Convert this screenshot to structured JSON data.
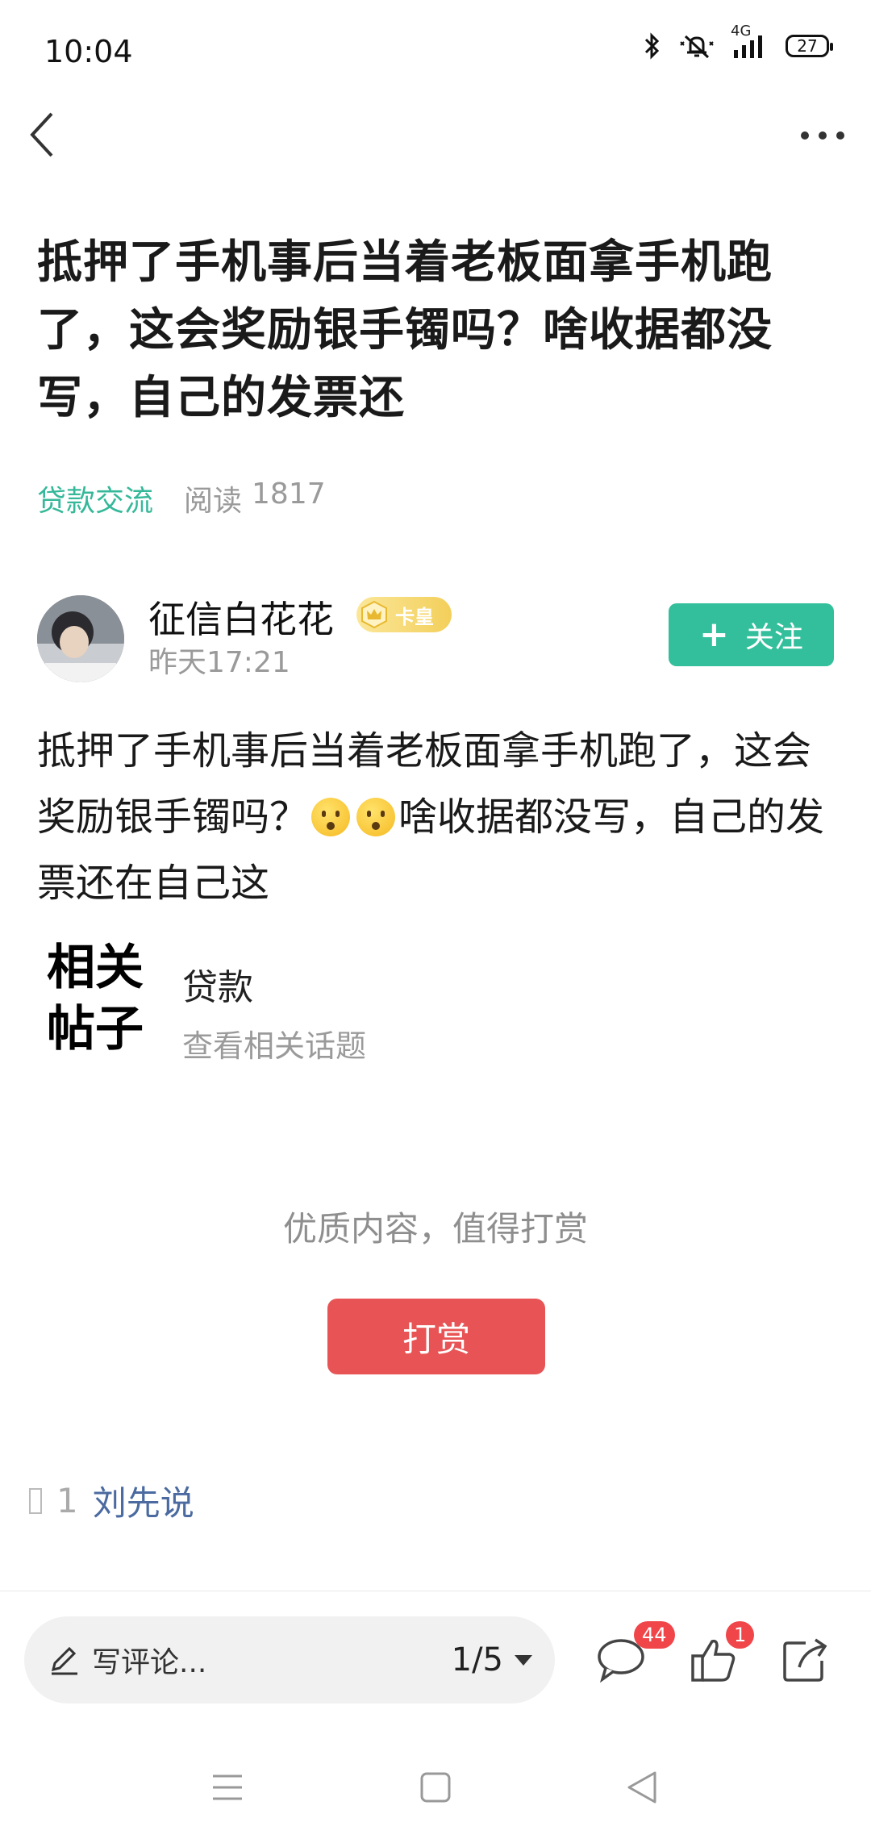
{
  "status_bar": {
    "time": "10:04",
    "network": "4G",
    "battery": "27"
  },
  "icons": {
    "back": "back-chevron-icon",
    "more": "more-dots-icon",
    "bluetooth": "bluetooth-icon",
    "mute": "mute-bell-icon",
    "signal": "signal-icon",
    "battery": "battery-icon",
    "pencil": "pencil-icon",
    "comment": "comment-icon",
    "like": "thumbs-up-icon",
    "share": "share-icon",
    "crown": "crown-icon"
  },
  "post": {
    "title": "抵押了手机事后当着老板面拿手机跑了，这会奖励银手镯吗？啥收据都没写，自己的发票还",
    "category": "贷款交流",
    "read_label": "阅读",
    "read_count": "1817",
    "body_part1": "抵押了手机事后当着老板面拿手机跑了，这会奖励银手镯吗？",
    "body_part2": "啥收据都没写，自己的发票还在自己这"
  },
  "author": {
    "name": "征信白花花",
    "badge": "卡皇",
    "time": "昨天17:21",
    "follow_label": "关注"
  },
  "related": {
    "label_line1": "相关",
    "label_line2": "帖子",
    "topic": "贷款",
    "subtitle": "查看相关话题"
  },
  "reward": {
    "prompt": "优质内容，值得打赏",
    "button": "打赏"
  },
  "footer_author": {
    "count": "1",
    "name": "刘先说"
  },
  "bottom_bar": {
    "comment_placeholder": "写评论...",
    "page_indicator": "1/5",
    "comment_count": "44",
    "like_count": "1"
  },
  "colors": {
    "accent_green": "#33bf9b",
    "reward_red": "#e85455",
    "badge_red": "#f0464a"
  }
}
